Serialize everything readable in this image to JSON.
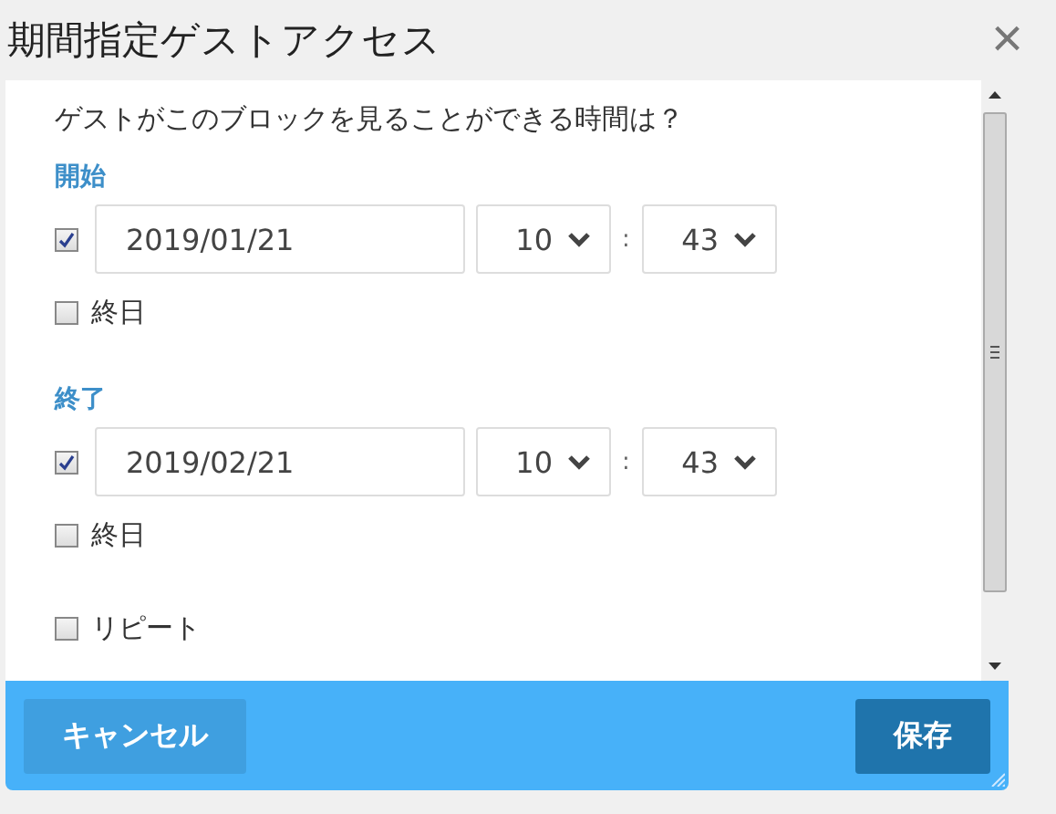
{
  "dialog": {
    "title": "期間指定ゲストアクセス",
    "close": "×",
    "question": "ゲストがこのブロックを見ることができる時間は？",
    "sections": [
      {
        "heading": "開始",
        "enabled": true,
        "date": "2019/01/21",
        "hour": "10",
        "minute": "43",
        "separator": ":",
        "all_day": {
          "label": "終日",
          "checked": false
        }
      },
      {
        "heading": "終了",
        "enabled": true,
        "date": "2019/02/21",
        "hour": "10",
        "minute": "43",
        "separator": ":",
        "all_day": {
          "label": "終日",
          "checked": false
        }
      }
    ],
    "repeat": {
      "label": "リピート",
      "checked": false
    },
    "buttons": [
      {
        "label": "キャンセル",
        "kind": "secondary"
      },
      {
        "label": "保存",
        "kind": "primary"
      }
    ]
  }
}
